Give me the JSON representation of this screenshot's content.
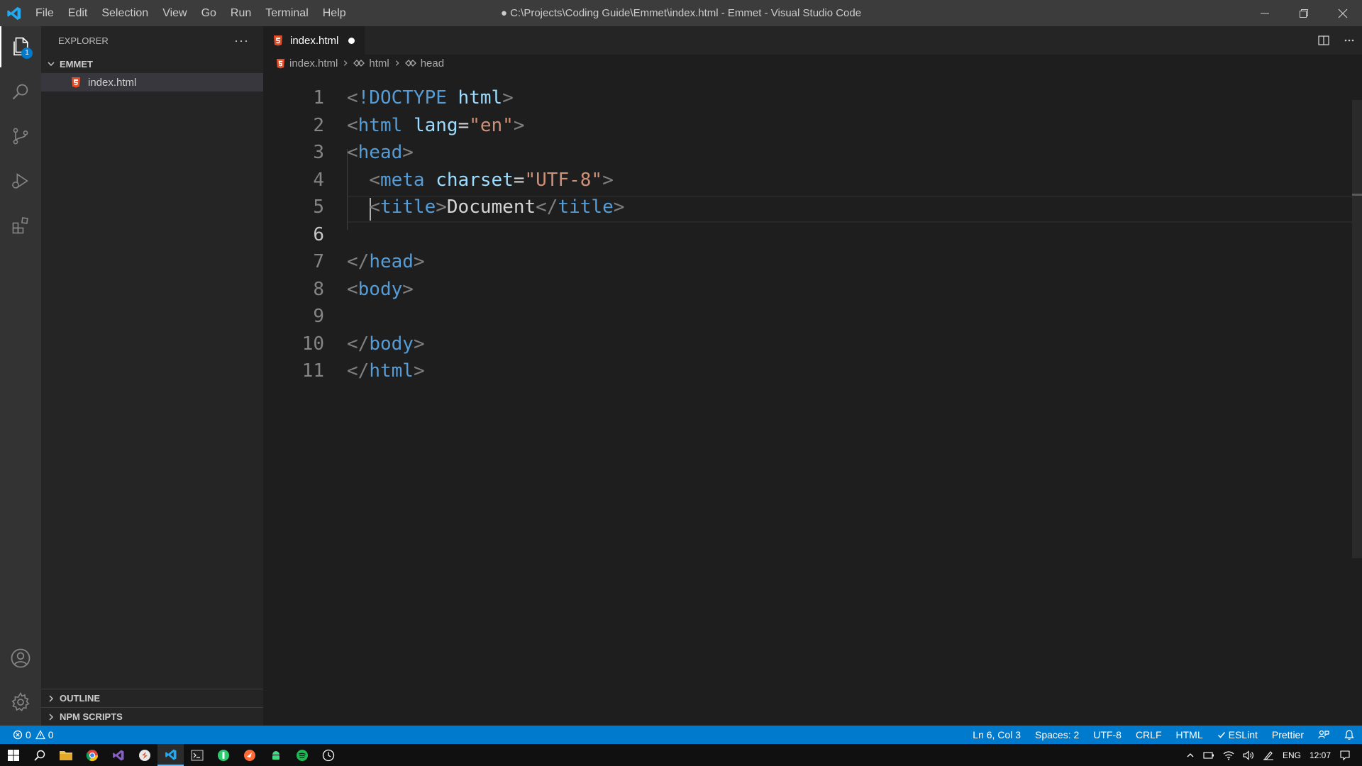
{
  "titlebar": {
    "menu": [
      "File",
      "Edit",
      "Selection",
      "View",
      "Go",
      "Run",
      "Terminal",
      "Help"
    ],
    "window_title": "● C:\\Projects\\Coding Guide\\Emmet\\index.html - Emmet - Visual Studio Code"
  },
  "activity": {
    "explorer_badge": "1"
  },
  "sidebar": {
    "title": "EXPLORER",
    "more": "···",
    "folder": "EMMET",
    "file": "index.html",
    "outline": "OUTLINE",
    "npm_scripts": "NPM SCRIPTS"
  },
  "editor": {
    "tab_label": "index.html",
    "breadcrumb": [
      "index.html",
      "html",
      "head"
    ],
    "lines": [
      {
        "n": "1",
        "tokens": [
          [
            "br",
            "<"
          ],
          [
            "tag",
            "!DOCTYPE"
          ],
          [
            "text",
            " "
          ],
          [
            "attr",
            "html"
          ],
          [
            "br",
            ">"
          ]
        ]
      },
      {
        "n": "2",
        "tokens": [
          [
            "br",
            "<"
          ],
          [
            "tag",
            "html"
          ],
          [
            "text",
            " "
          ],
          [
            "attr",
            "lang"
          ],
          [
            "text",
            "="
          ],
          [
            "str",
            "\"en\""
          ],
          [
            "br",
            ">"
          ]
        ]
      },
      {
        "n": "3",
        "tokens": [
          [
            "br",
            "<"
          ],
          [
            "tag",
            "head"
          ],
          [
            "br",
            ">"
          ]
        ]
      },
      {
        "n": "4",
        "tokens": [
          [
            "text",
            "  "
          ],
          [
            "br",
            "<"
          ],
          [
            "tag",
            "meta"
          ],
          [
            "text",
            " "
          ],
          [
            "attr",
            "charset"
          ],
          [
            "text",
            "="
          ],
          [
            "str",
            "\"UTF-8\""
          ],
          [
            "br",
            ">"
          ]
        ]
      },
      {
        "n": "5",
        "tokens": [
          [
            "text",
            "  "
          ],
          [
            "br",
            "<"
          ],
          [
            "tag",
            "title"
          ],
          [
            "br",
            ">"
          ],
          [
            "text",
            "Document"
          ],
          [
            "br",
            "</"
          ],
          [
            "tag",
            "title"
          ],
          [
            "br",
            ">"
          ]
        ]
      },
      {
        "n": "6",
        "tokens": []
      },
      {
        "n": "7",
        "tokens": [
          [
            "br",
            "</"
          ],
          [
            "tag",
            "head"
          ],
          [
            "br",
            ">"
          ]
        ]
      },
      {
        "n": "8",
        "tokens": [
          [
            "br",
            "<"
          ],
          [
            "tag",
            "body"
          ],
          [
            "br",
            ">"
          ]
        ]
      },
      {
        "n": "9",
        "tokens": []
      },
      {
        "n": "10",
        "tokens": [
          [
            "br",
            "</"
          ],
          [
            "tag",
            "body"
          ],
          [
            "br",
            ">"
          ]
        ]
      },
      {
        "n": "11",
        "tokens": [
          [
            "br",
            "</"
          ],
          [
            "tag",
            "html"
          ],
          [
            "br",
            ">"
          ]
        ]
      }
    ],
    "current_line": "6"
  },
  "statusbar": {
    "errors": "0",
    "warnings": "0",
    "position": "Ln 6, Col 3",
    "spaces": "Spaces: 2",
    "encoding": "UTF-8",
    "eol": "CRLF",
    "language": "HTML",
    "eslint": "ESLint",
    "prettier": "Prettier"
  },
  "taskbar": {
    "lang": "ENG",
    "time": "12:07"
  },
  "colors": {
    "accent": "#007acc",
    "html5": "#e44d26"
  }
}
